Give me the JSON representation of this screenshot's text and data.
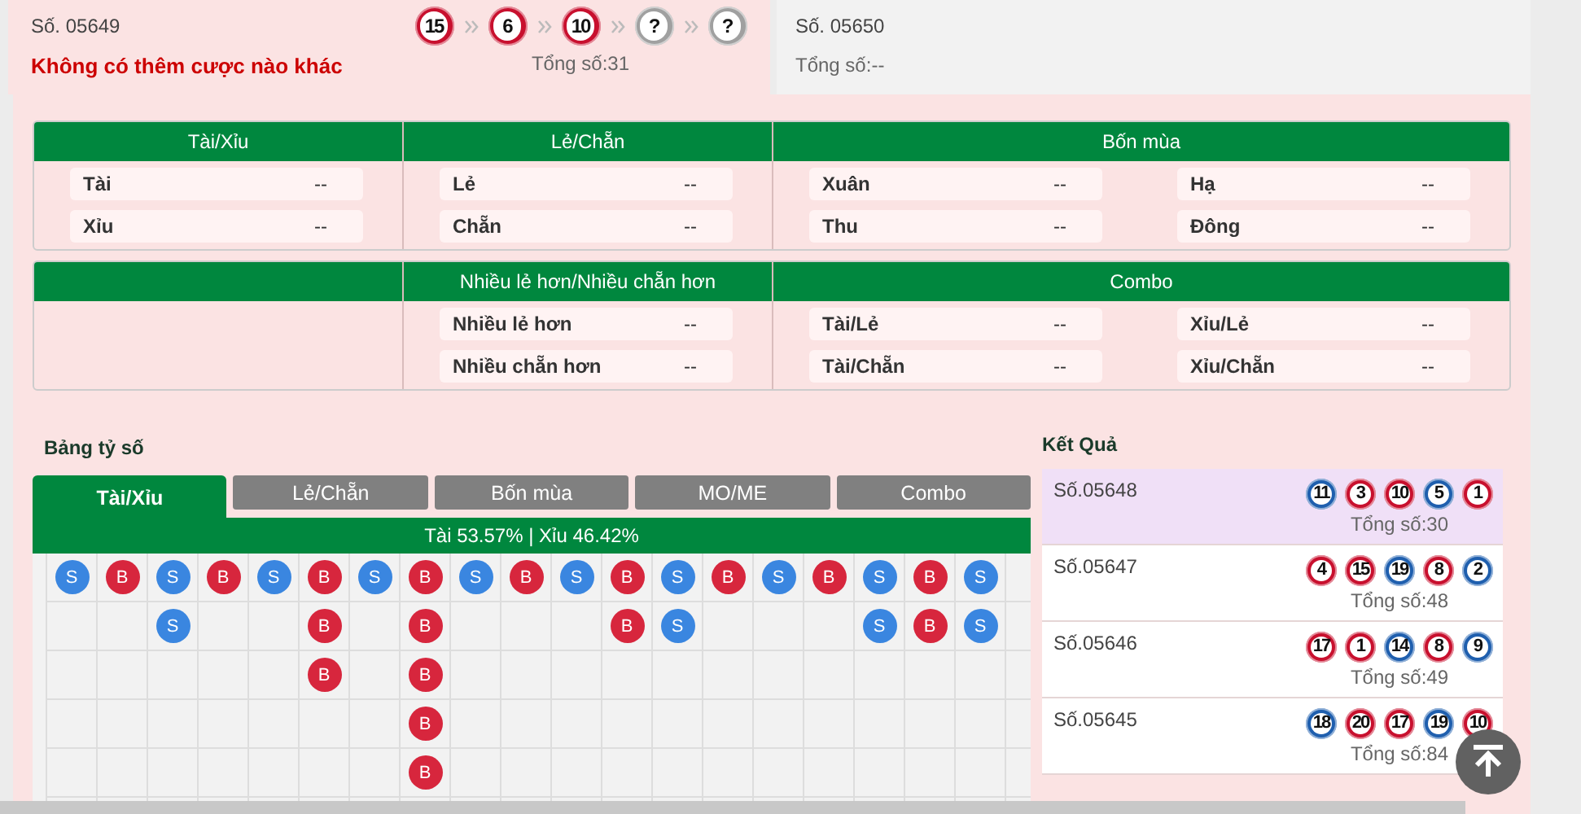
{
  "current": {
    "issue": "Số. 05649",
    "message": "Không có thêm cược nào khác",
    "balls": [
      {
        "text": "15",
        "color": "#c8102e"
      },
      {
        "text": "6",
        "color": "#c8102e"
      },
      {
        "text": "10",
        "color": "#c8102e"
      },
      {
        "text": "?",
        "color": "#a0a0a0"
      },
      {
        "text": "?",
        "color": "#a0a0a0"
      }
    ],
    "total": "Tổng số:31"
  },
  "next": {
    "issue": "Số. 05650",
    "total": "Tổng số:--"
  },
  "stat_tables": [
    {
      "groups": [
        {
          "kind": "group",
          "header": "Tài/Xỉu",
          "columns": [
            [
              {
                "label": "Tài",
                "value": "--"
              },
              {
                "label": "Xỉu",
                "value": "--"
              }
            ]
          ]
        },
        {
          "kind": "group",
          "header": "Lẻ/Chẵn",
          "columns": [
            [
              {
                "label": "Lẻ",
                "value": "--"
              },
              {
                "label": "Chẵn",
                "value": "--"
              }
            ]
          ]
        },
        {
          "kind": "group",
          "header": "Bốn mùa",
          "columns": [
            [
              {
                "label": "Xuân",
                "value": "--"
              },
              {
                "label": "Thu",
                "value": "--"
              }
            ],
            [
              {
                "label": "Hạ",
                "value": "--"
              },
              {
                "label": "Đông",
                "value": "--"
              }
            ]
          ]
        }
      ]
    },
    {
      "groups": [
        {
          "kind": "blank"
        },
        {
          "kind": "group",
          "header": "Nhiều lẻ hơn/Nhiều chẵn hơn",
          "columns": [
            [
              {
                "label": "Nhiều lẻ hơn",
                "value": "--"
              },
              {
                "label": "Nhiều chẵn hơn",
                "value": "--"
              }
            ]
          ]
        },
        {
          "kind": "group",
          "header": "Combo",
          "columns": [
            [
              {
                "label": "Tài/Lẻ",
                "value": "--"
              },
              {
                "label": "Tài/Chẵn",
                "value": "--"
              }
            ],
            [
              {
                "label": "Xỉu/Lẻ",
                "value": "--"
              },
              {
                "label": "Xỉu/Chẵn",
                "value": "--"
              }
            ]
          ]
        }
      ]
    }
  ],
  "scoreboard": {
    "title": "Bảng tỷ số",
    "tabs": [
      {
        "label": "Tài/Xỉu",
        "selected": true
      },
      {
        "label": "Lẻ/Chẵn",
        "selected": false
      },
      {
        "label": "Bốn mùa",
        "selected": false
      },
      {
        "label": "MO/ME",
        "selected": false
      },
      {
        "label": "Combo",
        "selected": false
      }
    ],
    "summary": "Tài 53.57% | Xỉu 46.42%",
    "bead_columns": [
      [
        {
          "text": "S",
          "color": "#3a86e0"
        }
      ],
      [
        {
          "text": "B",
          "color": "#d7263d"
        }
      ],
      [
        {
          "text": "S",
          "color": "#3a86e0"
        },
        {
          "text": "S",
          "color": "#3a86e0"
        }
      ],
      [
        {
          "text": "B",
          "color": "#d7263d"
        }
      ],
      [
        {
          "text": "S",
          "color": "#3a86e0"
        }
      ],
      [
        {
          "text": "B",
          "color": "#d7263d"
        },
        {
          "text": "B",
          "color": "#d7263d"
        },
        {
          "text": "B",
          "color": "#d7263d"
        }
      ],
      [
        {
          "text": "S",
          "color": "#3a86e0"
        }
      ],
      [
        {
          "text": "B",
          "color": "#d7263d"
        },
        {
          "text": "B",
          "color": "#d7263d"
        },
        {
          "text": "B",
          "color": "#d7263d"
        },
        {
          "text": "B",
          "color": "#d7263d"
        },
        {
          "text": "B",
          "color": "#d7263d"
        }
      ],
      [
        {
          "text": "S",
          "color": "#3a86e0"
        }
      ],
      [
        {
          "text": "B",
          "color": "#d7263d"
        }
      ],
      [
        {
          "text": "S",
          "color": "#3a86e0"
        }
      ],
      [
        {
          "text": "B",
          "color": "#d7263d"
        },
        {
          "text": "B",
          "color": "#d7263d"
        }
      ],
      [
        {
          "text": "S",
          "color": "#3a86e0"
        },
        {
          "text": "S",
          "color": "#3a86e0"
        }
      ],
      [
        {
          "text": "B",
          "color": "#d7263d"
        }
      ],
      [
        {
          "text": "S",
          "color": "#3a86e0"
        }
      ],
      [
        {
          "text": "B",
          "color": "#d7263d"
        }
      ],
      [
        {
          "text": "S",
          "color": "#3a86e0"
        },
        {
          "text": "S",
          "color": "#3a86e0"
        }
      ],
      [
        {
          "text": "B",
          "color": "#d7263d"
        },
        {
          "text": "B",
          "color": "#d7263d"
        }
      ],
      [
        {
          "text": "S",
          "color": "#3a86e0"
        },
        {
          "text": "S",
          "color": "#3a86e0"
        }
      ]
    ]
  },
  "results": {
    "title": "Kết Quả",
    "rows": [
      {
        "issue": "Số.05648",
        "selected": true,
        "total": "Tổng số:30",
        "balls": [
          {
            "text": "11",
            "color": "#1f5fae"
          },
          {
            "text": "3",
            "color": "#c8102e"
          },
          {
            "text": "10",
            "color": "#c8102e"
          },
          {
            "text": "5",
            "color": "#1f5fae"
          },
          {
            "text": "1",
            "color": "#c8102e"
          }
        ]
      },
      {
        "issue": "Số.05647",
        "selected": false,
        "total": "Tổng số:48",
        "balls": [
          {
            "text": "4",
            "color": "#c8102e"
          },
          {
            "text": "15",
            "color": "#c8102e"
          },
          {
            "text": "19",
            "color": "#1f5fae"
          },
          {
            "text": "8",
            "color": "#c8102e"
          },
          {
            "text": "2",
            "color": "#1f5fae"
          }
        ]
      },
      {
        "issue": "Số.05646",
        "selected": false,
        "total": "Tổng số:49",
        "balls": [
          {
            "text": "17",
            "color": "#c8102e"
          },
          {
            "text": "1",
            "color": "#c8102e"
          },
          {
            "text": "14",
            "color": "#1f5fae"
          },
          {
            "text": "8",
            "color": "#c8102e"
          },
          {
            "text": "9",
            "color": "#1f5fae"
          }
        ]
      },
      {
        "issue": "Số.05645",
        "selected": false,
        "total": "Tổng số:84",
        "balls": [
          {
            "text": "18",
            "color": "#1f5fae"
          },
          {
            "text": "20",
            "color": "#c8102e"
          },
          {
            "text": "17",
            "color": "#c8102e"
          },
          {
            "text": "19",
            "color": "#1f5fae"
          },
          {
            "text": "10",
            "color": "#c8102e"
          }
        ]
      }
    ]
  }
}
